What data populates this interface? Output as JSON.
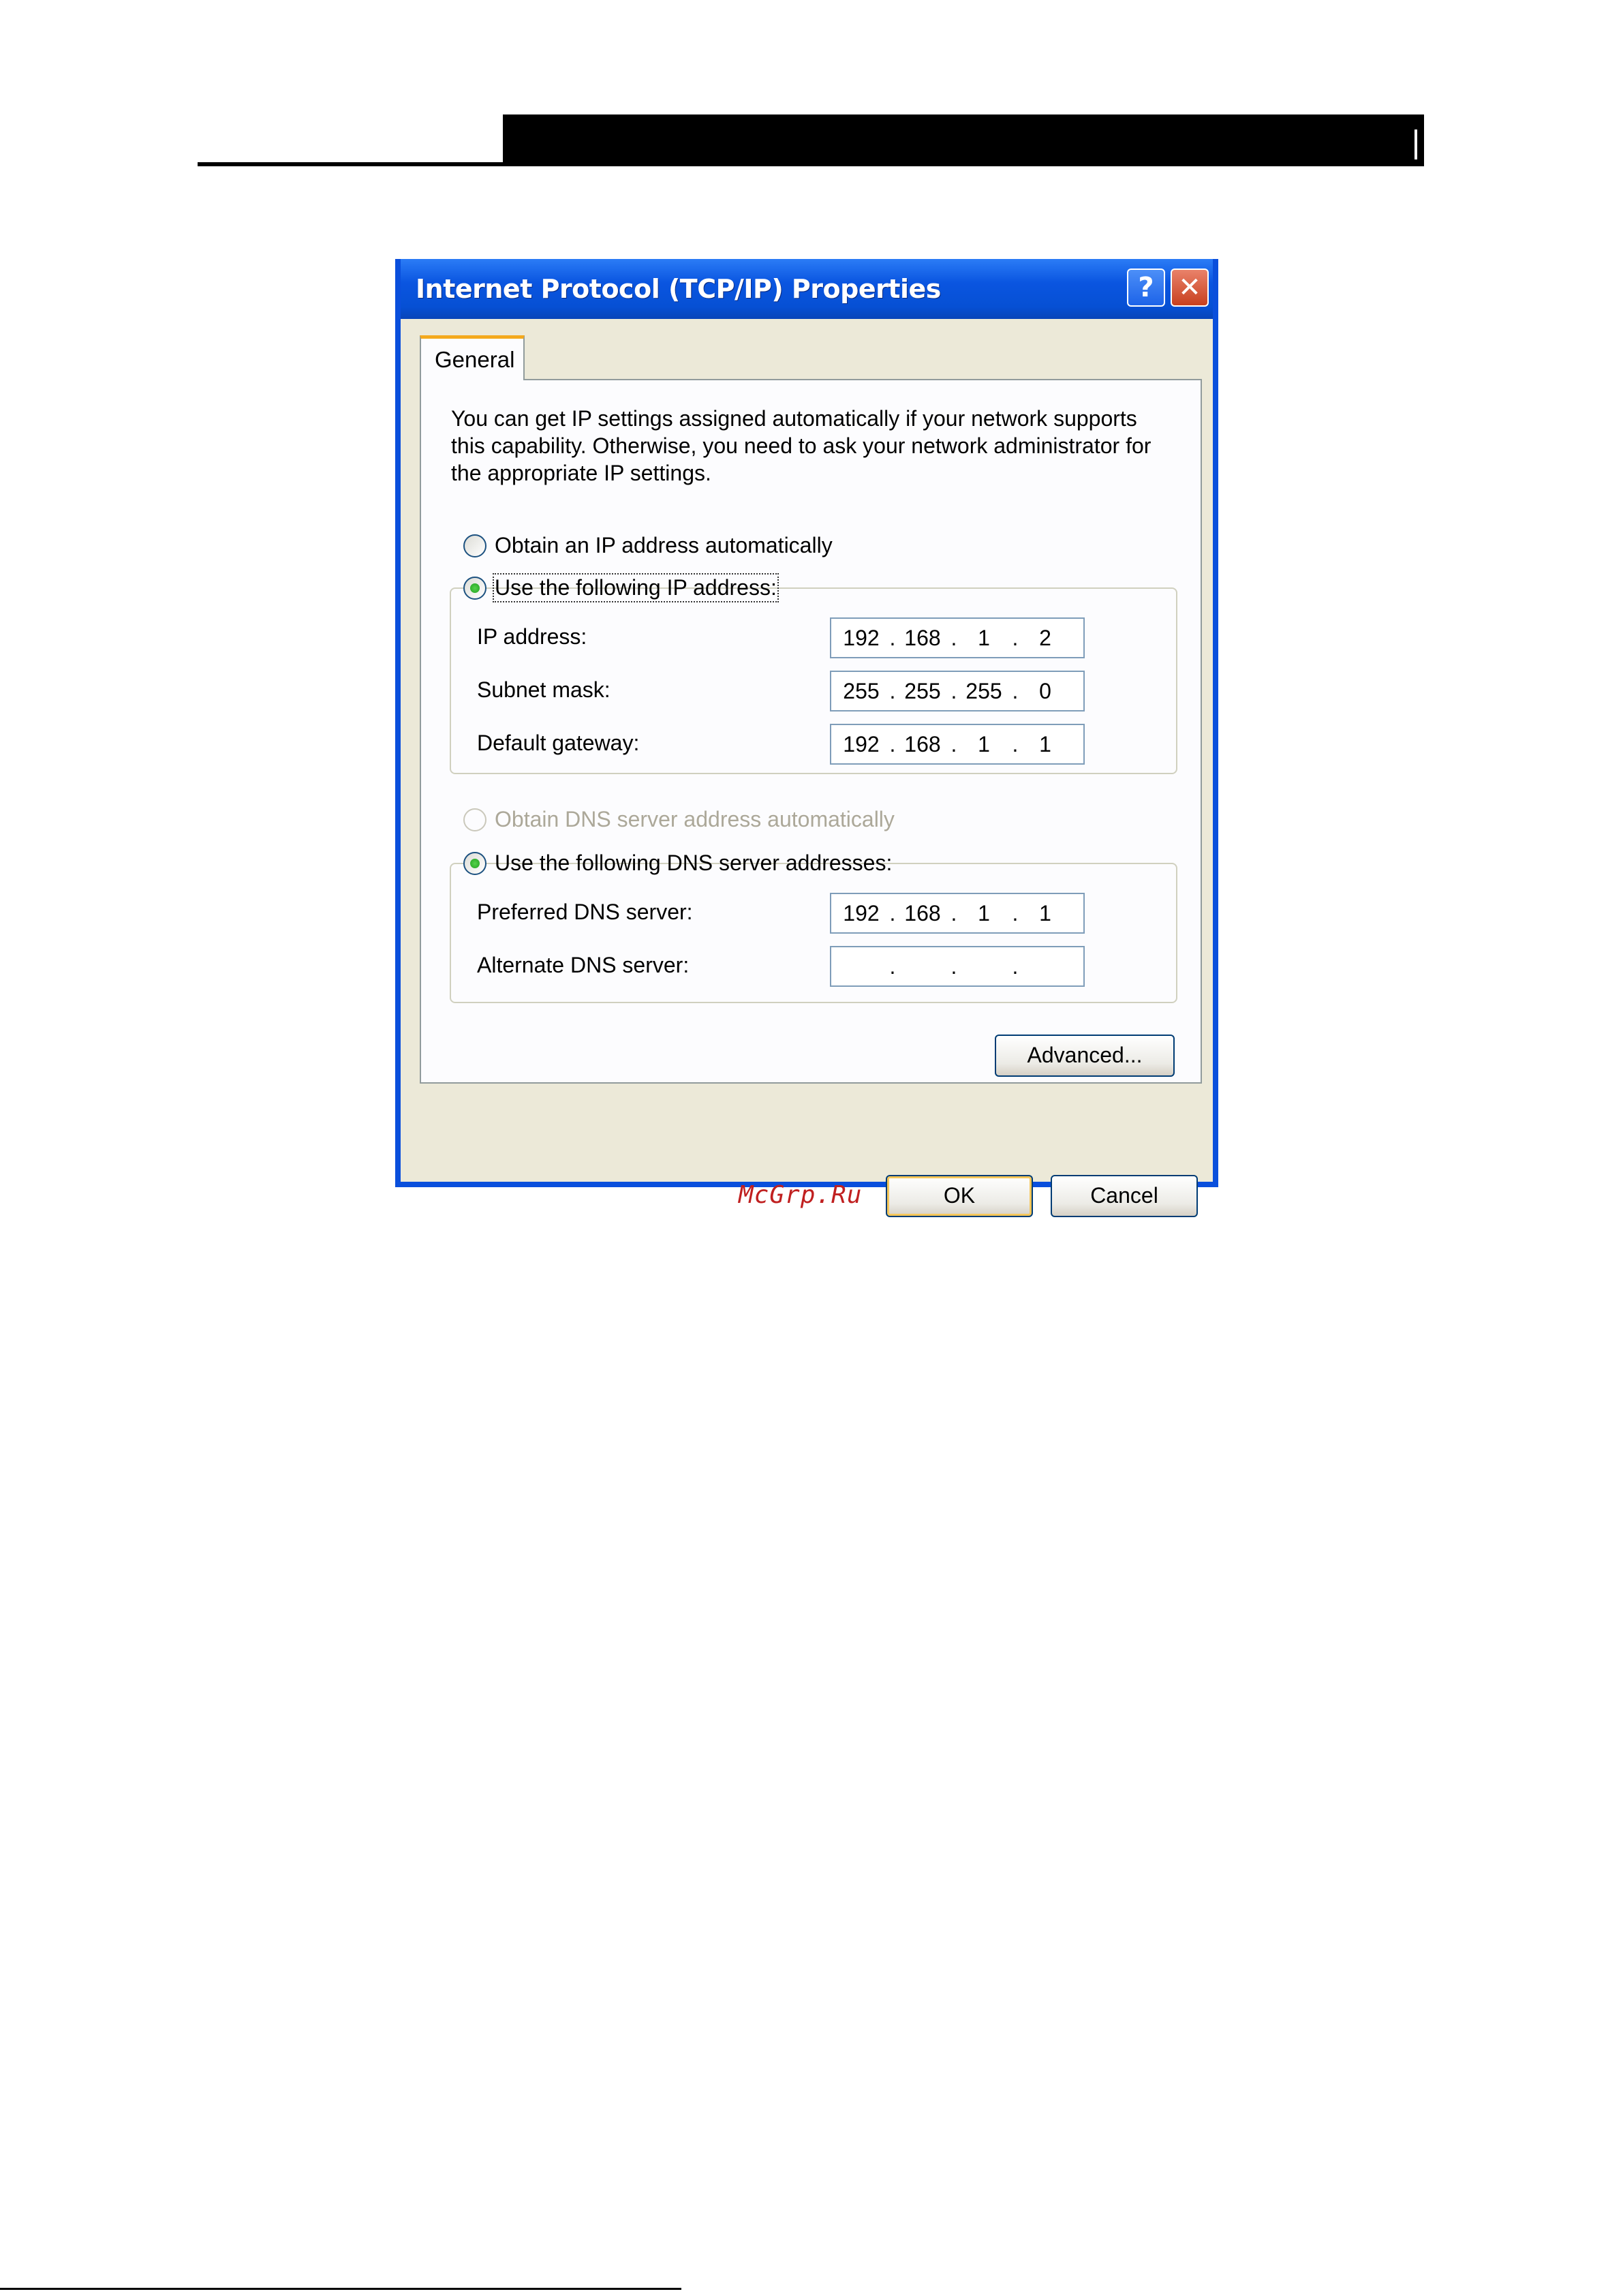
{
  "dialog": {
    "title": "Internet Protocol (TCP/IP) Properties",
    "help_glyph": "?",
    "close_glyph": "✕",
    "tab": "General",
    "description": "You can get IP settings assigned automatically if your network supports this capability. Otherwise, you need to ask your network administrator for the appropriate IP settings.",
    "ip_mode": {
      "auto_label": "Obtain an IP address automatically",
      "manual_label": "Use the following IP address:",
      "selected": "manual"
    },
    "ip_fields": [
      {
        "label": "IP address:",
        "octets": [
          "192",
          "168",
          "1",
          "2"
        ]
      },
      {
        "label": "Subnet mask:",
        "octets": [
          "255",
          "255",
          "255",
          "0"
        ]
      },
      {
        "label": "Default gateway:",
        "octets": [
          "192",
          "168",
          "1",
          "1"
        ]
      }
    ],
    "dns_mode": {
      "auto_label": "Obtain DNS server address automatically",
      "manual_label": "Use the following DNS server addresses:",
      "selected": "manual",
      "auto_disabled": true
    },
    "dns_fields": [
      {
        "label": "Preferred DNS server:",
        "octets": [
          "192",
          "168",
          "1",
          "1"
        ]
      },
      {
        "label": "Alternate DNS server:",
        "octets": [
          "",
          "",
          "",
          ""
        ]
      }
    ],
    "advanced_label": "Advanced...",
    "ok_label": "OK",
    "cancel_label": "Cancel",
    "watermark": "McGrp.Ru",
    "dot": "."
  },
  "colors": {
    "title_bar": "#0a55e0",
    "dialog_face": "#ece9d8",
    "tab_accent": "#f4a91d",
    "radio_dot": "#21a121",
    "watermark": "#c02020"
  },
  "icons": [
    "help-icon",
    "close-icon"
  ]
}
